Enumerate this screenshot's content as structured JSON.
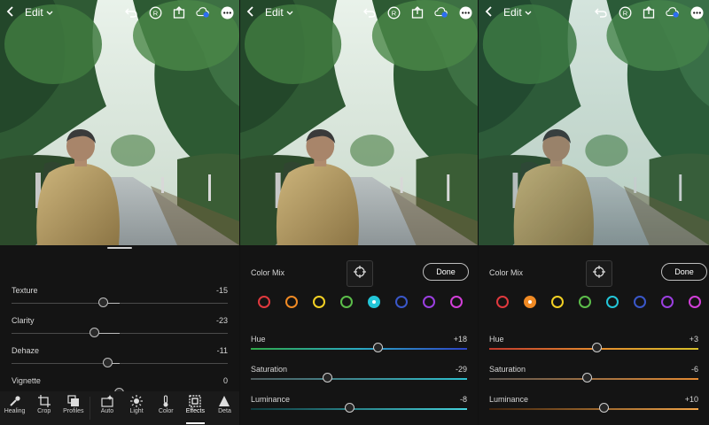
{
  "header": {
    "back_icon": "chevron-left-icon",
    "edit_label": "Edit"
  },
  "panel1": {
    "adjustments": [
      {
        "label": "Texture",
        "value": "-15",
        "level": -15
      },
      {
        "label": "Clarity",
        "value": "-23",
        "level": -23
      },
      {
        "label": "Dehaze",
        "value": "-11",
        "level": -11
      },
      {
        "label": "Vignette",
        "value": "0",
        "level": 0
      }
    ],
    "toolbar": [
      {
        "label": "Healing",
        "icon": "healing-brush-icon"
      },
      {
        "label": "Crop",
        "icon": "crop-icon"
      },
      {
        "label": "Profiles",
        "icon": "profiles-icon"
      },
      {
        "label": "Auto",
        "icon": "auto-icon"
      },
      {
        "label": "Light",
        "icon": "light-sun-icon"
      },
      {
        "label": "Color",
        "icon": "thermometer-icon"
      },
      {
        "label": "Effects",
        "icon": "effects-icon",
        "active": true
      },
      {
        "label": "Deta",
        "icon": "detail-icon"
      }
    ]
  },
  "panel2": {
    "title": "Color Mix",
    "done_label": "Done",
    "selected_swatch": "aqua",
    "adjustments": [
      {
        "label": "Hue",
        "value": "+18",
        "level": 18
      },
      {
        "label": "Saturation",
        "value": "-29",
        "level": -29
      },
      {
        "label": "Luminance",
        "value": "-8",
        "level": -8
      }
    ]
  },
  "panel3": {
    "title": "Color Mix",
    "done_label": "Done",
    "selected_swatch": "orange",
    "adjustments": [
      {
        "label": "Hue",
        "value": "+3",
        "level": 3
      },
      {
        "label": "Saturation",
        "value": "-6",
        "level": -6
      },
      {
        "label": "Luminance",
        "value": "+10",
        "level": 10
      }
    ]
  },
  "swatches": [
    {
      "name": "red",
      "color": "#e0393e"
    },
    {
      "name": "orange",
      "color": "#f08a24"
    },
    {
      "name": "yellow",
      "color": "#f2d024"
    },
    {
      "name": "green",
      "color": "#5cbd4a"
    },
    {
      "name": "aqua",
      "color": "#23c6d8"
    },
    {
      "name": "blue",
      "color": "#3a57c9"
    },
    {
      "name": "purple",
      "color": "#9b3fe0"
    },
    {
      "name": "magenta",
      "color": "#d23fd8"
    }
  ],
  "colors": {
    "aqua_hue_gradient": [
      "#2fa84a",
      "#2aa9c2",
      "#2d45c7"
    ],
    "aqua_sat_gradient": [
      "#4f5a5c",
      "#2dc0cf"
    ],
    "aqua_lum_gradient": [
      "#0f3a3d",
      "#46d3dd"
    ],
    "orange_hue_gradient": [
      "#c0392b",
      "#e58a2e",
      "#d9c02a"
    ],
    "orange_sat_gradient": [
      "#5d5650",
      "#e48b33"
    ],
    "orange_lum_gradient": [
      "#3d220c",
      "#f2a54a"
    ]
  }
}
